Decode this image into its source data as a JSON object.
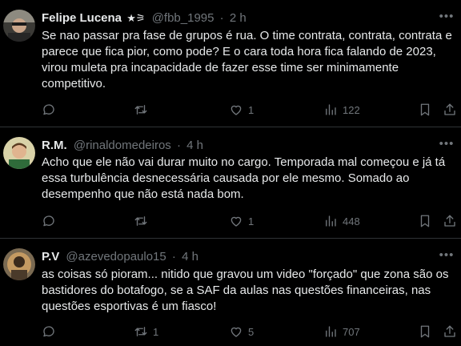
{
  "tweets": [
    {
      "name": "Felipe Lucena",
      "badge": "★⚞",
      "handle": "@fbb_1995",
      "separator": "·",
      "time": "2 h",
      "text": "Se nao passar pra fase de grupos é rua. O time contrata, contrata, contrata e parece que fica pior, como pode? E o cara toda hora fica falando de 2023, virou muleta pra incapacidade de fazer esse time ser minimamente competitivo.",
      "replies": "",
      "retweets": "",
      "likes": "1",
      "views": "122"
    },
    {
      "name": "R.M.",
      "handle": "@rinaldomedeiros",
      "separator": "·",
      "time": "4 h",
      "text": "Acho que ele não vai durar muito no cargo. Temporada mal começou e já tá essa turbulência desnecessária causada por ele mesmo. Somado ao desempenho que não está nada bom.",
      "replies": "",
      "retweets": "",
      "likes": "1",
      "views": "448"
    },
    {
      "name": "P.V",
      "handle": "@azevedopaulo15",
      "separator": "·",
      "time": "4 h",
      "text": "as coisas só pioram... nitido que gravou um video \"forçado\" que zona são os bastidores do botafogo, se a SAF da aulas nas questões financeiras, nas questões esportivas é um fiasco!",
      "replies": "",
      "retweets": "1",
      "likes": "5",
      "views": "707"
    }
  ],
  "icons": {
    "reply": "reply-icon",
    "retweet": "retweet-icon",
    "like": "heart-icon",
    "views": "views-icon",
    "bookmark": "bookmark-icon",
    "share": "share-icon",
    "more": "more-icon"
  },
  "colors": {
    "background": "#000000",
    "text": "#e7e9ea",
    "muted": "#71767b",
    "divider": "#2f3336"
  }
}
